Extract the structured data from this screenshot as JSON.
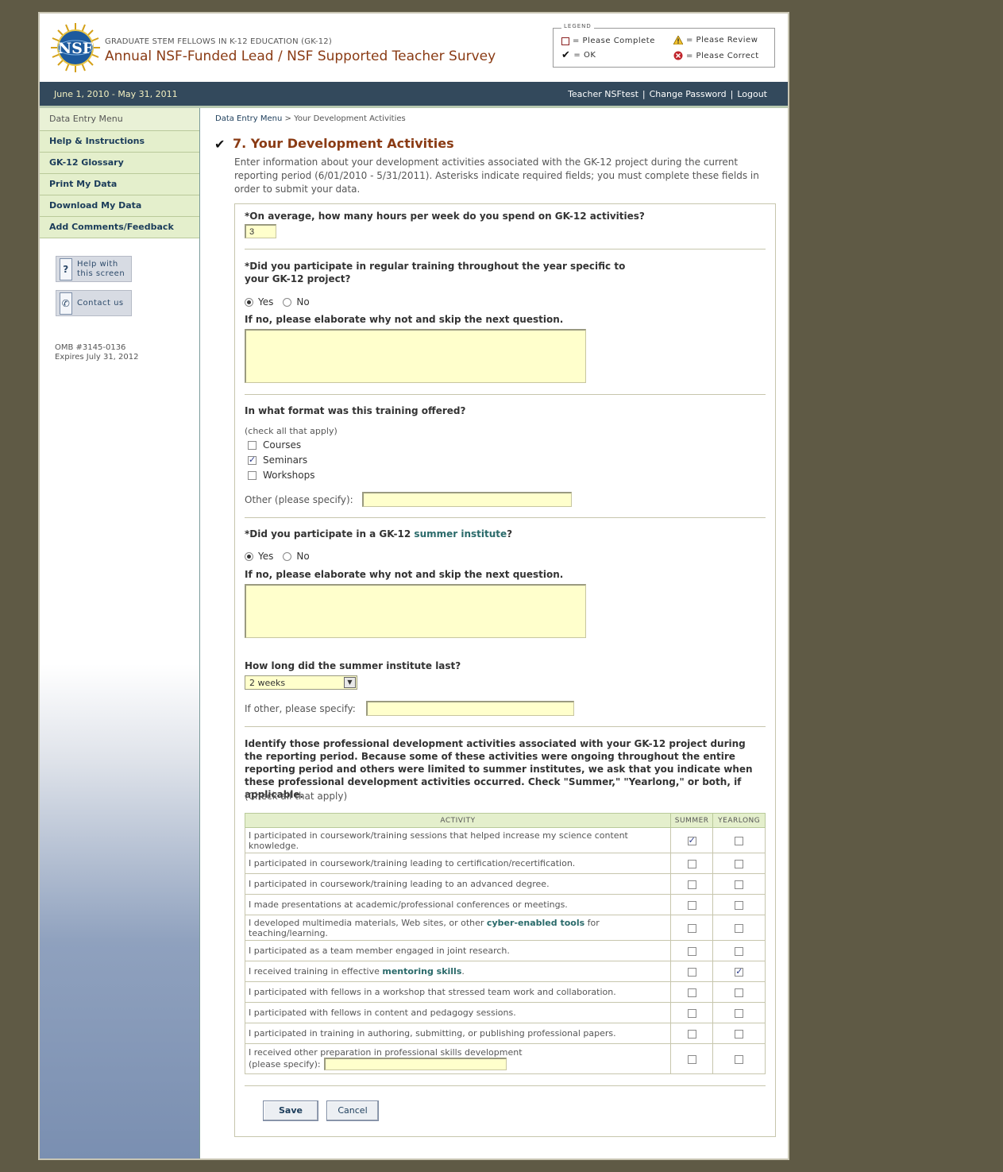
{
  "header": {
    "subtitle": "GRADUATE STEM FELLOWS IN K-12 EDUCATION (GK-12)",
    "title": "Annual NSF-Funded Lead / NSF Supported Teacher Survey",
    "logo_text": "NSF"
  },
  "legend": {
    "title": "LEGEND",
    "please_complete": "= Please Complete",
    "please_review": "= Please Review",
    "ok": "= OK",
    "please_correct": "= Please Correct"
  },
  "topbar": {
    "dates": "June 1, 2010 - May 31, 2011",
    "user": "Teacher NSFtest",
    "change_password": "Change Password",
    "logout": "Logout",
    "separator": "|"
  },
  "sidebar": {
    "menu_heading": "Data Entry Menu",
    "items": [
      {
        "label": "Help & Instructions"
      },
      {
        "label": "GK-12 Glossary"
      },
      {
        "label": "Print My Data"
      },
      {
        "label": "Download My Data"
      },
      {
        "label": "Add Comments/Feedback"
      }
    ],
    "help_button": {
      "line1": "Help with",
      "line2": "this screen"
    },
    "contact_button": {
      "label": "Contact us"
    },
    "omb_line1": "OMB #3145-0136",
    "omb_line2": "Expires July 31, 2012"
  },
  "breadcrumb": {
    "root": "Data Entry Menu",
    "separator": ">",
    "current": "Your Development Activities"
  },
  "page": {
    "title": "7. Your Development Activities",
    "intro": "Enter information about your development activities associated with the GK-12 project during the current reporting period (6/01/2010 - 5/31/2011). Asterisks indicate required fields; you must complete these fields in order to submit your data."
  },
  "q_hours": {
    "label": "*On average, how many hours per week do you spend on GK-12 activities?",
    "value": "3"
  },
  "q_training": {
    "label_line1": "*Did you participate in regular training throughout the year specific to",
    "label_line2": "your GK-12 project?",
    "yes": "Yes",
    "no": "No",
    "selected": "yes",
    "elaborate_label": "If no, please elaborate why not and skip the next question.",
    "elaborate_value": ""
  },
  "q_format": {
    "label": "In what format was this training offered?",
    "note": "(check all that apply)",
    "options": [
      {
        "label": "Courses",
        "checked": false
      },
      {
        "label": "Seminars",
        "checked": true
      },
      {
        "label": "Workshops",
        "checked": false
      }
    ],
    "other_label": "Other (please specify):",
    "other_value": ""
  },
  "q_summer": {
    "label_prefix": "*Did you participate in a GK-12",
    "label_link": "summer institute",
    "label_suffix": "?",
    "yes": "Yes",
    "no": "No",
    "selected": "yes",
    "elaborate_label": "If no, please elaborate why not and skip the next question.",
    "elaborate_value": ""
  },
  "q_duration": {
    "label": "How long did the summer institute last?",
    "selected": "2 weeks",
    "other_label": "If other, please specify:",
    "other_value": ""
  },
  "q_activities": {
    "text": "Identify those professional development activities associated with your GK-12 project during the reporting period. Because some of these activities were ongoing throughout the entire reporting period and others were limited to summer institutes, we ask that you indicate when these professional development activities occurred. Check \"Summer,\" \"Yearlong,\" or both, if applicable.",
    "note": "(Check all that apply)",
    "col_activity": "ACTIVITY",
    "col_summer": "SUMMER",
    "col_yearlong": "YEARLONG",
    "rows": [
      {
        "pre": "I participated in coursework/training sessions that helped increase my science content knowledge.",
        "link": "",
        "post": "",
        "summer": true,
        "yearlong": false
      },
      {
        "pre": "I participated in coursework/training leading to certification/recertification.",
        "link": "",
        "post": "",
        "summer": false,
        "yearlong": false
      },
      {
        "pre": "I participated in coursework/training leading to an advanced degree.",
        "link": "",
        "post": "",
        "summer": false,
        "yearlong": false
      },
      {
        "pre": "I made presentations at academic/professional conferences or meetings.",
        "link": "",
        "post": "",
        "summer": false,
        "yearlong": false
      },
      {
        "pre": "I developed multimedia materials, Web sites, or other ",
        "link": "cyber-enabled tools",
        "post": " for teaching/learning.",
        "summer": false,
        "yearlong": false
      },
      {
        "pre": "I participated as a team member engaged in joint research.",
        "link": "",
        "post": "",
        "summer": false,
        "yearlong": false
      },
      {
        "pre": "I received training in effective ",
        "link": "mentoring skills",
        "post": ".",
        "summer": false,
        "yearlong": true
      },
      {
        "pre": "I participated with fellows in a workshop that stressed team work and collaboration.",
        "link": "",
        "post": "",
        "summer": false,
        "yearlong": false
      },
      {
        "pre": "I participated with fellows in content and pedagogy sessions.",
        "link": "",
        "post": "",
        "summer": false,
        "yearlong": false
      },
      {
        "pre": "I participated in training in authoring, submitting, or publishing professional papers.",
        "link": "",
        "post": "",
        "summer": false,
        "yearlong": false
      }
    ],
    "other_row": {
      "line1": "I received other preparation in professional skills development",
      "line2": "(please specify):",
      "value": "",
      "summer": false,
      "yearlong": false
    }
  },
  "buttons": {
    "save": "Save",
    "cancel": "Cancel"
  }
}
